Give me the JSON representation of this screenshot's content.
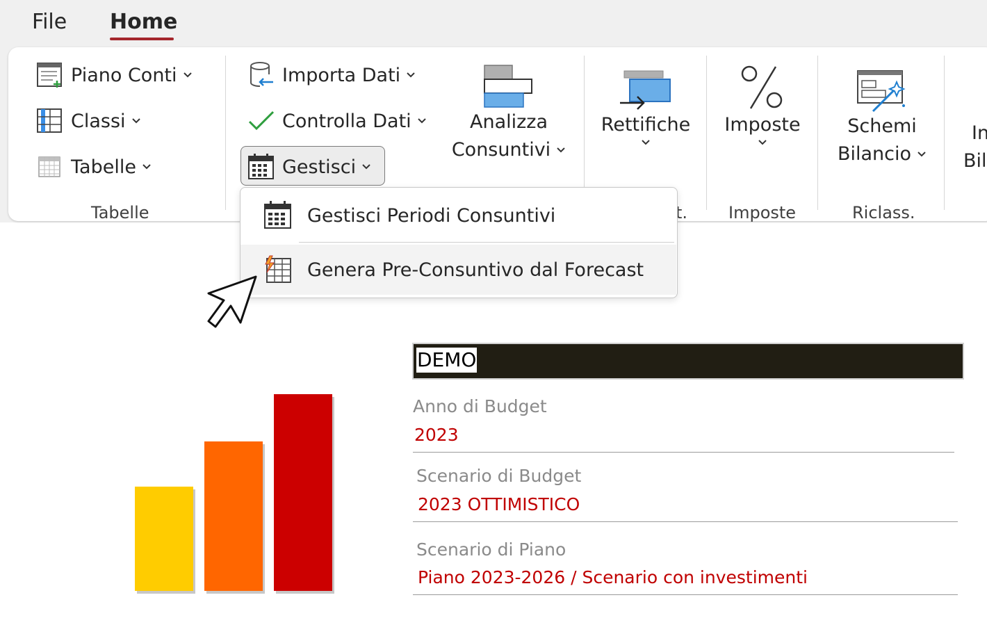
{
  "menu": {
    "file": "File",
    "home": "Home",
    "accent_color": "#a4262c"
  },
  "ribbon": {
    "tabelle_group": {
      "items": [
        {
          "label": "Piano Conti",
          "icon": "chart-of-accounts-icon"
        },
        {
          "label": "Classi",
          "icon": "classes-icon"
        },
        {
          "label": "Tabelle",
          "icon": "table-icon"
        }
      ],
      "group_label": "Tabelle"
    },
    "consuntivi_group": {
      "importa": "Importa Dati",
      "controlla": "Controlla Dati",
      "gestisci": "Gestisci",
      "analizza_line1": "Analizza",
      "analizza_line2": "Consuntivi",
      "group_label_fragment": "t."
    },
    "rettifiche": {
      "label": "Rettifiche"
    },
    "imposte": {
      "label": "Imposte",
      "group_label": "Imposte"
    },
    "schemi": {
      "line1": "Schemi",
      "line2": "Bilancio",
      "group_label": "Riclass."
    },
    "partial": {
      "line1": "In",
      "line2": "Bila"
    }
  },
  "dropdown": {
    "items": [
      {
        "label": "Gestisci Periodi Consuntivi",
        "icon": "calendar-icon"
      },
      {
        "label": "Genera Pre-Consuntivo dal Forecast",
        "icon": "lightning-grid-icon"
      }
    ]
  },
  "chart_data": {
    "type": "bar",
    "categories": [
      "",
      "",
      ""
    ],
    "values": [
      150,
      215,
      283
    ],
    "colors": [
      "#ffcc00",
      "#ff6600",
      "#cc0000"
    ],
    "ylim": [
      0,
      290
    ]
  },
  "info": {
    "demo": "DEMO",
    "fields": [
      {
        "label": "Anno di Budget",
        "value": "2023"
      },
      {
        "label": "Scenario di Budget",
        "value": "2023 OTTIMISTICO"
      },
      {
        "label": "Scenario di Piano",
        "value": "Piano 2023-2026 / Scenario con investimenti"
      }
    ]
  }
}
